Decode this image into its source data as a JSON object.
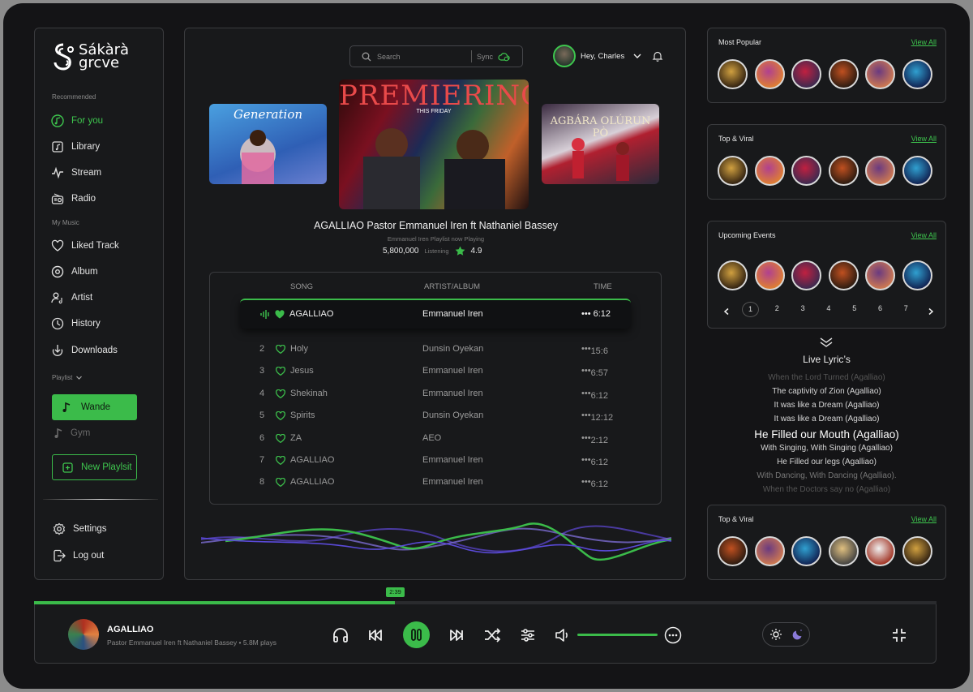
{
  "brand": {
    "line1": "Sákàrà",
    "line2": "grcve"
  },
  "sidebar": {
    "recommended_label": "Recommended",
    "recommended": [
      {
        "label": "For you",
        "icon": "music-note-circle-icon",
        "active": true
      },
      {
        "label": "Library",
        "icon": "library-icon"
      },
      {
        "label": "Stream",
        "icon": "pulse-icon"
      },
      {
        "label": "Radio",
        "icon": "radio-icon"
      }
    ],
    "mymusic_label": "My Music",
    "mymusic": [
      {
        "label": "Liked Track",
        "icon": "heart-icon"
      },
      {
        "label": "Album",
        "icon": "disc-icon"
      },
      {
        "label": "Artist",
        "icon": "artist-icon"
      },
      {
        "label": "History",
        "icon": "history-icon"
      },
      {
        "label": "Downloads",
        "icon": "download-icon"
      }
    ],
    "playlist_label": "Playlist",
    "playlists": [
      {
        "label": "Wande",
        "selected": true
      },
      {
        "label": "Gym",
        "selected": false
      }
    ],
    "new_playlist": "New Playlsit",
    "settings": "Settings",
    "logout": "Log out"
  },
  "header": {
    "search_placeholder": "Search",
    "sync_label": "Sync",
    "greeting": "Hey, Charles"
  },
  "featured": {
    "left_cover_text": "Generation",
    "center_cover_text": "PREMIERING",
    "center_cover_sub": "THIS FRIDAY",
    "right_cover_text": "AGBÁRA OLÚRUN PÒ",
    "title": "AGALLIAO  Pastor Emmanuel Iren ft Nathaniel Bassey",
    "subtitle": "Emmanuel Iren Playlist now Playing",
    "listens": "5,800,000",
    "listening_label": "Listening",
    "rating": "4.9"
  },
  "tracks": {
    "headers": {
      "song": "SONG",
      "artist": "ARTIST/ALBUM",
      "time": "TIME"
    },
    "now_playing": {
      "song": "AGALLIAO",
      "artist": "Emmanuel Iren",
      "time": "6:12"
    },
    "rows": [
      {
        "num": "2",
        "song": "Holy",
        "artist": "Dunsin Oyekan",
        "time": "15:6"
      },
      {
        "num": "3",
        "song": "Jesus",
        "artist": "Emmanuel Iren",
        "time": "6:57"
      },
      {
        "num": "4",
        "song": "Shekinah",
        "artist": "Emmanuel Iren",
        "time": "6:12"
      },
      {
        "num": "5",
        "song": "Spirits",
        "artist": "Dunsin Oyekan",
        "time": "12:12"
      },
      {
        "num": "6",
        "song": "ZA",
        "artist": "AEO",
        "time": "2:12"
      },
      {
        "num": "7",
        "song": "AGALLIAO",
        "artist": "Emmanuel Iren",
        "time": "6:12"
      },
      {
        "num": "8",
        "song": "AGALLIAO",
        "artist": "Emmanuel Iren",
        "time": "6:12"
      }
    ]
  },
  "right": {
    "most_popular": "Most Popular",
    "top_viral": "Top & Viral",
    "upcoming": "Upcoming Events",
    "view_all": "View All",
    "pages": [
      "1",
      "2",
      "3",
      "4",
      "5",
      "6",
      "7"
    ],
    "current_page": "1",
    "lyrics_title": "Live Lyric’s",
    "lyrics": [
      {
        "text": "When the Lord Turned (Agalliao)",
        "level": "faint"
      },
      {
        "text": "The captivity of Zion (Agalliao)",
        "level": "mid"
      },
      {
        "text": "It was like a Dream (Agalliao)",
        "level": "mid"
      },
      {
        "text": "It was like a Dream (Agalliao)",
        "level": "mid"
      },
      {
        "text": "He Filled our Mouth (Agalliao)",
        "level": "current"
      },
      {
        "text": "With Singing, With Singing (Agalliao)",
        "level": "mid"
      },
      {
        "text": "He Filled our legs (Agalliao)",
        "level": "mid"
      },
      {
        "text": "With Dancing, With Dancing (Agalliao).",
        "level": "dim"
      },
      {
        "text": "When the Doctors say no (Agalliao)",
        "level": "faint"
      }
    ]
  },
  "player": {
    "title": "AGALLIAO",
    "meta": "Pastor Emmanuel Iren ft Nathaniel Bassey  •  5.8M plays",
    "elapsed": "2:39",
    "progress": 0.4,
    "volume": 1.0
  },
  "colors": {
    "accent": "#3bbb4a",
    "bg": "#141416",
    "panel": "#18191b"
  }
}
